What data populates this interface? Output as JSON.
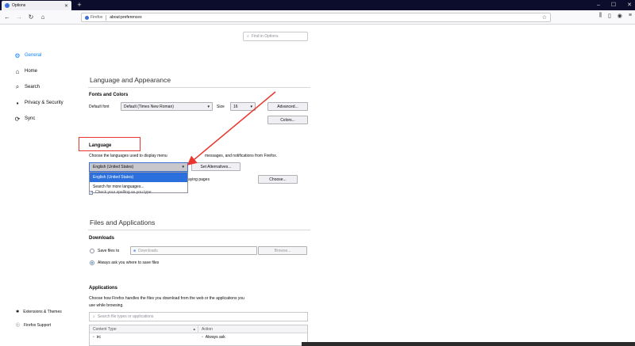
{
  "browser": {
    "tab_title": "Options",
    "new_tab": "+",
    "window_buttons": [
      "–",
      "☐",
      "✕"
    ],
    "url_identity": "Firefox",
    "url": "about:preferences",
    "toolbar_icons": [
      "library-icon",
      "sidebar-icon",
      "account-icon",
      "menu-icon"
    ]
  },
  "sidebar": {
    "items": [
      {
        "label": "General",
        "icon": "gear-icon",
        "active": true
      },
      {
        "label": "Home",
        "icon": "home-icon"
      },
      {
        "label": "Search",
        "icon": "search-icon"
      },
      {
        "label": "Privacy & Security",
        "icon": "lock-icon"
      },
      {
        "label": "Sync",
        "icon": "sync-icon"
      }
    ],
    "footer": [
      {
        "label": "Extensions & Themes",
        "icon": "puzzle-icon"
      },
      {
        "label": "Firefox Support",
        "icon": "help-icon"
      }
    ]
  },
  "find": {
    "placeholder": "Find in Options"
  },
  "language_appearance": {
    "heading": "Language and Appearance",
    "fonts_heading": "Fonts and Colors",
    "default_font_label": "Default font",
    "default_font_value": "Default (Times New Roman)",
    "size_label": "Size",
    "size_value": "16",
    "advanced_button": "Advanced...",
    "colors_button": "Colors...",
    "language_heading": "Language",
    "language_desc_a": "Choose the languages used to display menu",
    "language_desc_b": "messages, and notifications from Firefox.",
    "language_selected": "English (United States)",
    "language_options": [
      "English (United States)",
      "Search for more languages..."
    ],
    "set_alternatives_button": "Set Alternatives...",
    "partial_text": "aying pages",
    "choose_button": "Choose...",
    "spelling_check": "Check your spelling as you type"
  },
  "files_applications": {
    "heading": "Files and Applications",
    "downloads_heading": "Downloads",
    "save_files_label": "Save files to",
    "downloads_folder": "Downloads",
    "browse_button": "Browse...",
    "always_ask_label": "Always ask you where to save files",
    "applications_heading": "Applications",
    "applications_desc_1": "Choose how Firefox handles the files you download from the web or the applications you",
    "applications_desc_2": "use while browsing.",
    "search_placeholder": "Search file types or applications",
    "columns": [
      "Content Type",
      "Action"
    ],
    "rows": [
      {
        "type": "irc",
        "action": "Always ask"
      }
    ]
  },
  "colors": {
    "accent": "#0a84ff",
    "annotation": "#e8352e",
    "tabbar": "#0c0c2c"
  }
}
